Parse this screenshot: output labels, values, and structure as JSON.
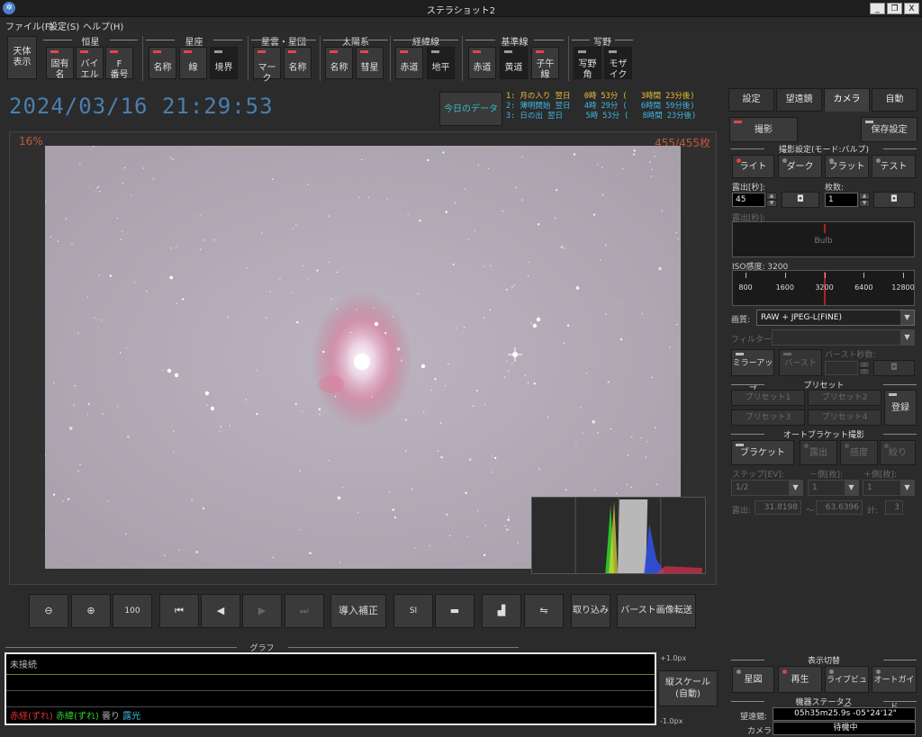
{
  "window": {
    "title": "ステラショット2",
    "btn_min": "_",
    "btn_max": "❐",
    "btn_close": "X",
    "app_icon": "✲"
  },
  "menu": [
    "ファイル(F)",
    "設定(S)",
    "ヘルプ(H)"
  ],
  "toolbar": {
    "sky_display": "天体\n表示",
    "groups": [
      {
        "title": "恒星",
        "buttons": [
          {
            "label": "固有\n名",
            "on": true
          },
          {
            "label": "バイ\nエル",
            "on": true
          },
          {
            "label": "F\n番号",
            "on": true
          }
        ]
      },
      {
        "title": "星座",
        "buttons": [
          {
            "label": "名称",
            "on": true
          },
          {
            "label": "線",
            "on": true
          },
          {
            "label": "境界",
            "on": false
          }
        ]
      },
      {
        "title": "星雲・星団",
        "buttons": [
          {
            "label": "マーク",
            "on": true
          },
          {
            "label": "名称",
            "on": true
          }
        ]
      },
      {
        "title": "太陽系",
        "buttons": [
          {
            "label": "名称",
            "on": true
          },
          {
            "label": "彗星",
            "on": true
          }
        ]
      },
      {
        "title": "経緯線",
        "buttons": [
          {
            "label": "赤道",
            "on": true
          },
          {
            "label": "地平",
            "on": false
          }
        ]
      },
      {
        "title": "基準線",
        "buttons": [
          {
            "label": "赤道",
            "on": true
          },
          {
            "label": "黄道",
            "on": false
          },
          {
            "label": "子午\n線",
            "on": true
          }
        ]
      },
      {
        "title": "写野",
        "buttons": [
          {
            "label": "写野\n角",
            "on": false
          },
          {
            "label": "モザ\nイク",
            "on": false
          }
        ]
      }
    ]
  },
  "datetime": "2024/03/16  21:29:53",
  "today_data_button": "今日のデータ",
  "events": [
    {
      "text": "1: 月の入り 翌日   0時 53分 (   3時間 23分後)",
      "color": "#e6c23a"
    },
    {
      "text": "2: 薄明開始 翌日   4時 29分 (   6時間 59分後)",
      "color": "#3fb6e0"
    },
    {
      "text": "3: 日の出 翌日     5時 53分 (   8時間 23分後)",
      "color": "#3fb6e0"
    }
  ],
  "viewer": {
    "zoom": "16%",
    "frame_count": "455/455枚"
  },
  "controls": {
    "zoom_out_icon": "⊖",
    "zoom_in_icon": "⊕",
    "actual_size": "100",
    "first_icon": "⏮",
    "prev_icon": "◀",
    "play_icon": "▶",
    "last_icon": "⏭",
    "intro_correction": "導入補正",
    "si_icon": "SI",
    "folder_icon": "▬",
    "histogram_icon": "▟",
    "compare_icon": "⇋",
    "capture": "取り込み",
    "burst_transfer": "バースト画像転送"
  },
  "graph": {
    "title": "グラフ",
    "status": "未接続",
    "legend": [
      {
        "text": "赤経(ずれ)",
        "color": "#e03030"
      },
      {
        "text": " ",
        "color": "#000000"
      },
      {
        "text": "赤緯(ずれ)",
        "color": "#30d030"
      },
      {
        "text": " 曇り ",
        "color": "#aaaaaa"
      },
      {
        "text": "露光",
        "color": "#3fb6e0"
      }
    ],
    "y_top": "+1.0px",
    "y_bottom": "-1.0px",
    "scale_button": "縦スケール\n(自動)"
  },
  "right_panel": {
    "tabs": [
      "設定",
      "望遠鏡",
      "カメラ",
      "自動"
    ],
    "active_tab": 2,
    "shoot": "撮影",
    "save_settings": "保存設定",
    "shoot_settings_title": "撮影設定(モード:バルブ)",
    "frame_types": [
      "ライト",
      "ダーク",
      "フラット",
      "テスト"
    ],
    "exposure_label": "露出[秒]:",
    "exposure_value": "45",
    "count_label": "枚数:",
    "count_value": "1",
    "exposure2_label": "露出[秒]:",
    "bulb": "Bulb",
    "iso_label": "ISO感度: 3200",
    "iso_ticks": [
      "800",
      "1600",
      "3200",
      "6400",
      "12800"
    ],
    "quality_label": "画質:",
    "quality_value": "RAW + JPEG-L(FINE)",
    "filter_label": "フィルター:",
    "mirror_up": "ミラーアップ",
    "burst": "バースト",
    "burst_seconds_label": "バースト秒数:",
    "preset_title": "プリセット",
    "presets": [
      "プリセット1",
      "プリセット2",
      "プリセット3",
      "プリセット4"
    ],
    "register": "登録",
    "auto_bracket_title": "オートブラケット撮影",
    "bracket_buttons": [
      "ブラケット",
      "露出",
      "感度",
      "絞り"
    ],
    "step_label": "ステップ[EV]:",
    "minus_label": "－側[枚]:",
    "plus_label": "＋側[枚]:",
    "step_value": "1/2",
    "minus_value": "1",
    "plus_value": "1",
    "exposure_range_label": "露出:",
    "exposure_min": "31.8198",
    "tilde": "～",
    "exposure_max": "63.6396",
    "total_label": "計:",
    "total_value": "3",
    "display_switch_title": "表示切替",
    "display_buttons": [
      "星図",
      "再生",
      "ライブビュー",
      "オートガイド"
    ],
    "equipment_status_title": "機器ステータス",
    "telescope_label": "望遠鏡:",
    "telescope_value": "05h35m25.9s -05°24'12\"",
    "camera_label": "カメラ:",
    "camera_value": "待機中"
  }
}
